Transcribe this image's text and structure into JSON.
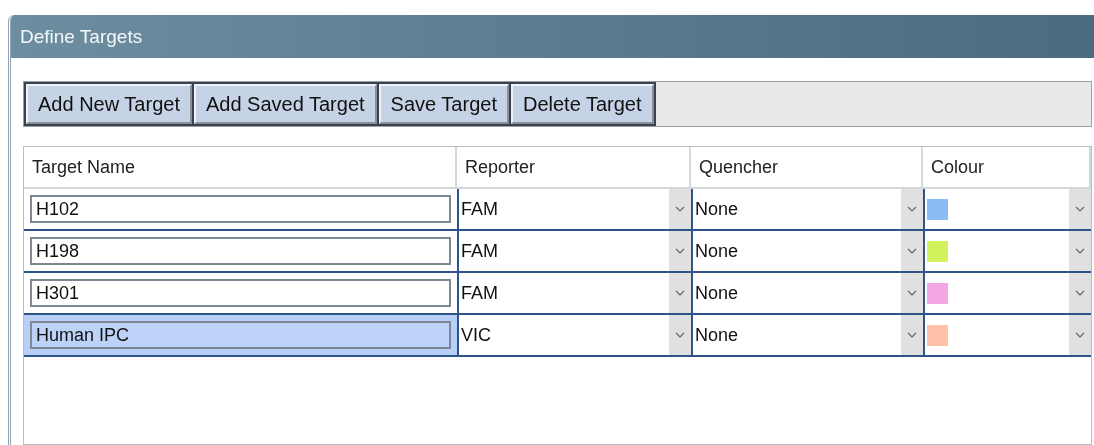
{
  "panel": {
    "title": "Define Targets"
  },
  "toolbar": {
    "buttons": [
      "Add New Target",
      "Add Saved Target",
      "Save Target",
      "Delete Target"
    ]
  },
  "table": {
    "columns": [
      "Target Name",
      "Reporter",
      "Quencher",
      "Colour"
    ],
    "rows": [
      {
        "name": "H102",
        "reporter": "FAM",
        "quencher": "None",
        "color": "#8bbcf5",
        "selected": false
      },
      {
        "name": "H198",
        "reporter": "FAM",
        "quencher": "None",
        "color": "#d1f25d",
        "selected": false
      },
      {
        "name": "H301",
        "reporter": "FAM",
        "quencher": "None",
        "color": "#f2a6e4",
        "selected": false
      },
      {
        "name": "Human IPC",
        "reporter": "VIC",
        "quencher": "None",
        "color": "#ffc1a8",
        "selected": true
      }
    ]
  }
}
